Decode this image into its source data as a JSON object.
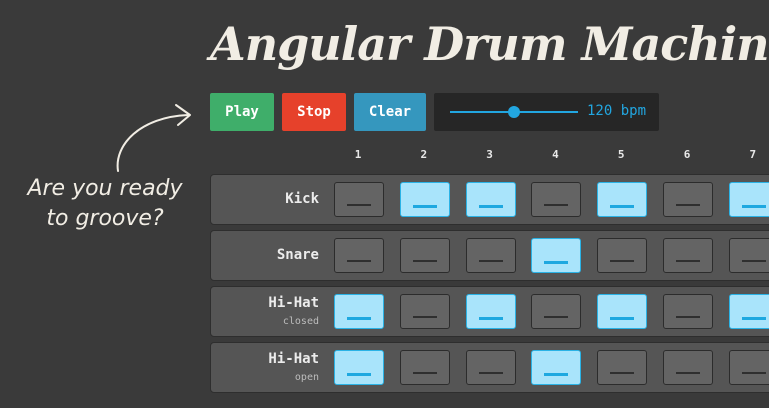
{
  "header": {
    "title": "Angular Drum Machine"
  },
  "controls": {
    "play_label": "Play",
    "stop_label": "Stop",
    "clear_label": "Clear",
    "tempo_display": "120 bpm",
    "tempo_slider_fraction": 0.5
  },
  "aside": {
    "line1": "Are you ready",
    "line2": "to groove?"
  },
  "colors": {
    "active_pad": "#a9e4fb",
    "accent": "#22a6e0",
    "play": "#3fae6a",
    "stop": "#e6412b",
    "clear": "#3597be"
  },
  "steps": [
    "1",
    "2",
    "3",
    "4",
    "5",
    "6",
    "7"
  ],
  "tracks": [
    {
      "name": "Kick",
      "sub": "",
      "pattern": [
        false,
        true,
        true,
        false,
        true,
        false,
        true
      ]
    },
    {
      "name": "Snare",
      "sub": "",
      "pattern": [
        false,
        false,
        false,
        true,
        false,
        false,
        false
      ]
    },
    {
      "name": "Hi-Hat",
      "sub": "closed",
      "pattern": [
        true,
        false,
        true,
        false,
        true,
        false,
        true
      ]
    },
    {
      "name": "Hi-Hat",
      "sub": "open",
      "pattern": [
        true,
        false,
        false,
        true,
        false,
        false,
        false
      ]
    }
  ]
}
